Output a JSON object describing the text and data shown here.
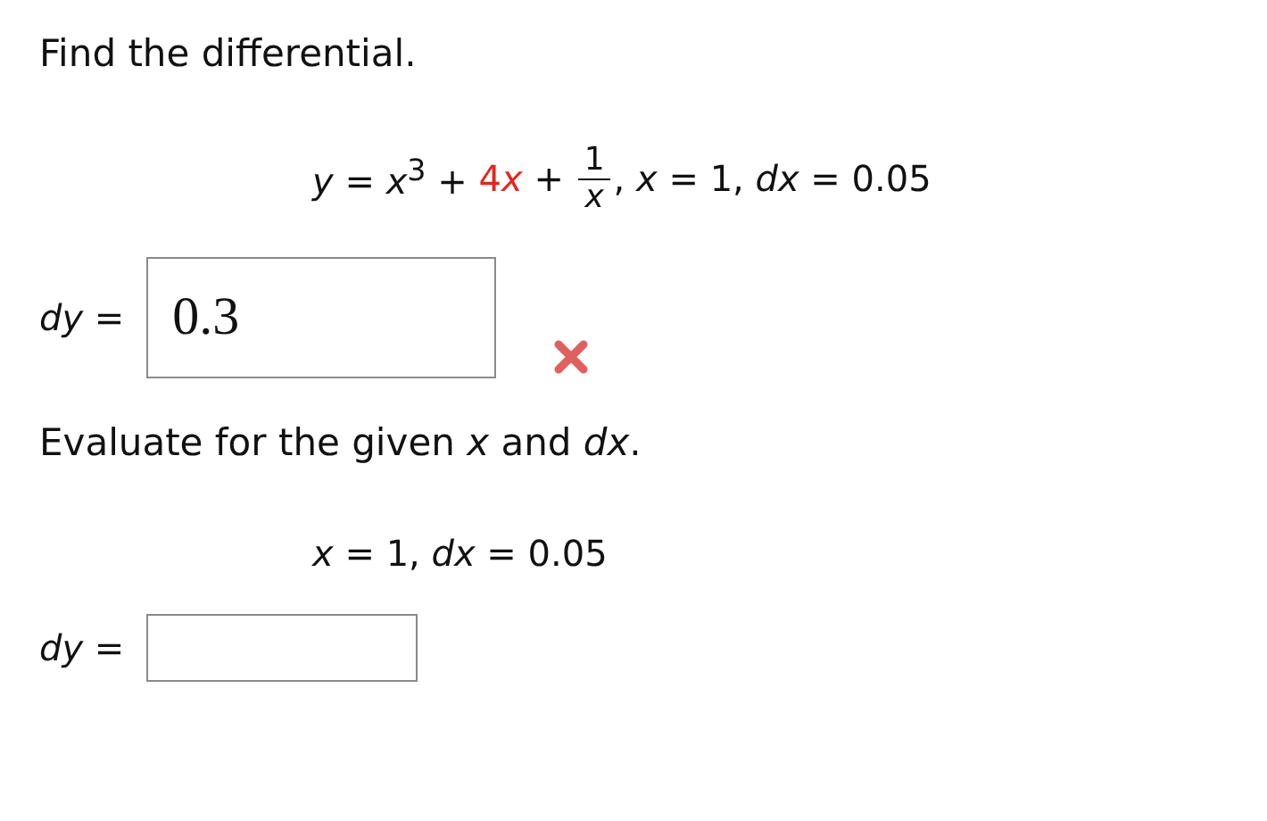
{
  "prompt": "Find the differential.",
  "equation": [
    {
      "kind": "text",
      "text": "*y* = *x*$^{3}$ + "
    },
    {
      "kind": "highlight",
      "coefficient": "4",
      "variable": "x"
    },
    {
      "kind": "text",
      "text": " + "
    },
    {
      "kind": "fraction",
      "numerator": "1",
      "denominator": "*x*"
    },
    {
      "kind": "text",
      "text": ", *x* = 1, *dx* = 0.05"
    }
  ],
  "first_answer": {
    "label": "*dy* =",
    "value": "0.3",
    "correct": false
  },
  "instruction": "Evaluate for the given *x* and *dx*.",
  "given": "*x* = 1, *dx* = 0.05",
  "second_answer": {
    "label": "*dy* ="
  }
}
